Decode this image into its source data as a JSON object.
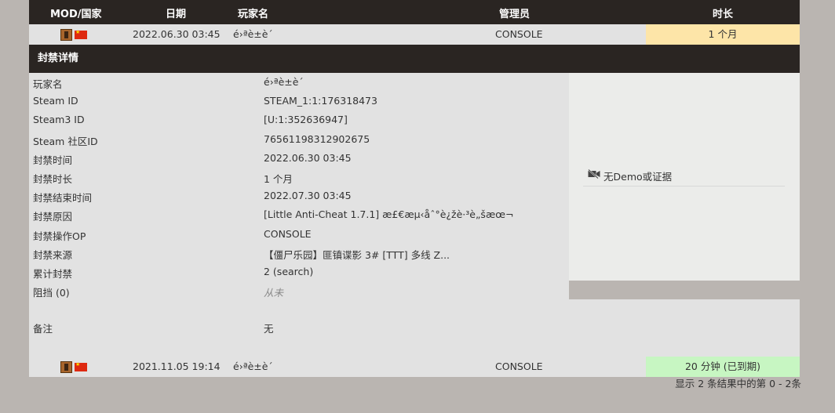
{
  "table": {
    "headers": {
      "mod_country": "MOD/国家",
      "date": "日期",
      "player": "玩家名",
      "admin": "管理员",
      "length": "时长"
    }
  },
  "bans": [
    {
      "date": "2022.06.30 03:45",
      "player": "é›ªè­±è´",
      "admin": "CONSOLE",
      "length": "1 个月",
      "status": "active"
    },
    {
      "date": "2021.11.05 19:14",
      "player": "é›ªè­±è´",
      "admin": "CONSOLE",
      "length": "20 分钟 (已到期)",
      "status": "expired"
    }
  ],
  "details": {
    "title": "封禁详情",
    "rows": [
      {
        "label": "玩家名",
        "value": "é›ªè­±è´"
      },
      {
        "label": "Steam ID",
        "value": "STEAM_1:1:176318473"
      },
      {
        "label": "Steam3 ID",
        "value": "[U:1:352636947]"
      },
      {
        "label": "Steam 社区ID",
        "value": "76561198312902675"
      },
      {
        "label": "封禁时间",
        "value": "2022.06.30 03:45"
      },
      {
        "label": "封禁时长",
        "value": "1 个月"
      },
      {
        "label": "封禁结束时间",
        "value": "2022.07.30 03:45"
      },
      {
        "label": "封禁原因",
        "value": "[Little Anti-Cheat 1.7.1] æ£€æµ‹åˆ°è¿žè·³è„šæœ¬"
      },
      {
        "label": "封禁操作OP",
        "value": "CONSOLE"
      },
      {
        "label": "封禁来源",
        "value": "【僵尸乐园】匪镇谍影 3# [TTT] 多线 Z..."
      },
      {
        "label": "累计封禁",
        "value": "2 (search)"
      },
      {
        "label": "阻挡 (0)",
        "value": "从未"
      }
    ],
    "remark_label": "备注",
    "remark_value": "无",
    "evidence": "无Demo或证据"
  },
  "pager": "显示 2 条结果中的第 0 - 2条",
  "colors": {
    "header_bg": "#2a2522",
    "active_length": "#fde5a8",
    "expired_length": "#c7f6c2",
    "page_bg": "#bab5b1"
  }
}
